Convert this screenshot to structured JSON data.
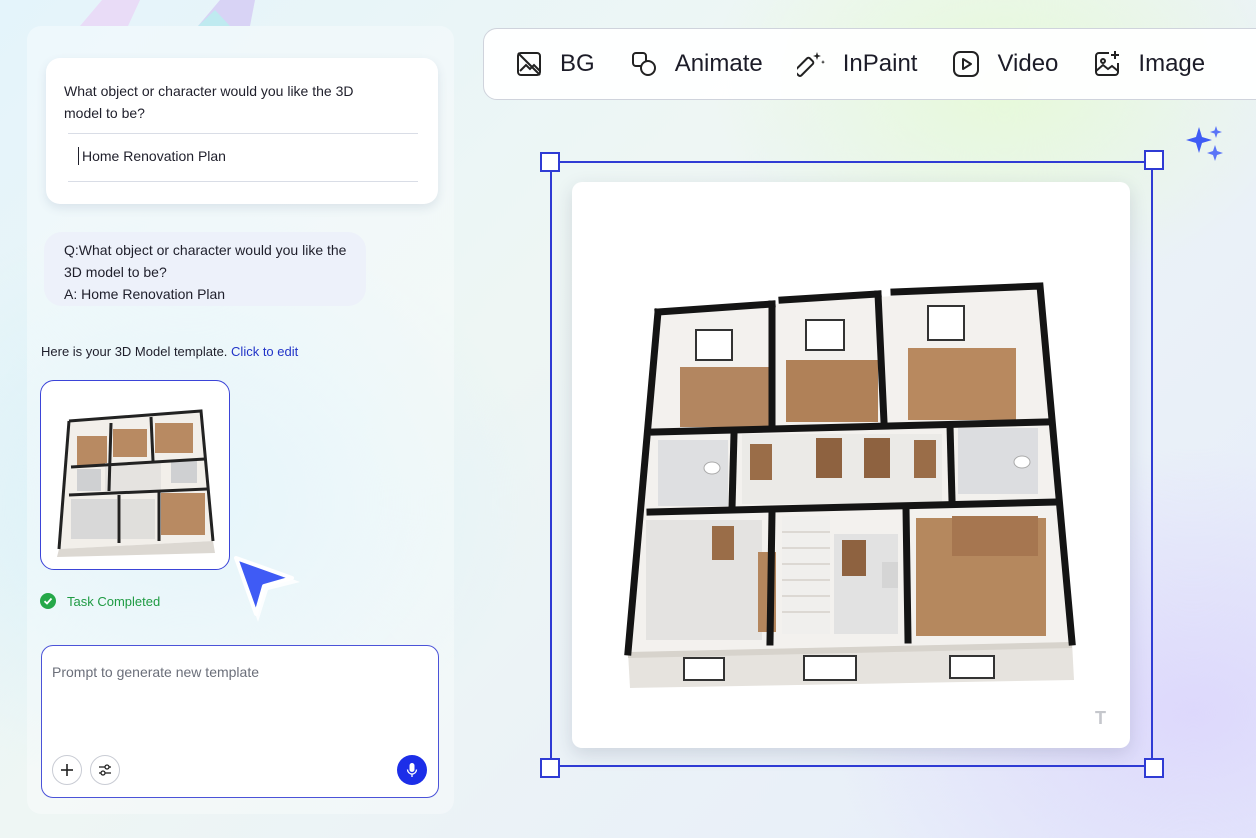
{
  "chat": {
    "question_card": {
      "question": "What object or character would you like the 3D model to be?",
      "answer_value": "Home Renovation Plan"
    },
    "summary_bubble": {
      "q_line": "Q:What object or character would you like the 3D model to be?",
      "a_line": "A: Home Renovation Plan"
    },
    "template_message": {
      "text": "Here is your 3D Model template.",
      "link": "Click to edit"
    },
    "status": {
      "text": "Task Completed",
      "color": "#1f9b43"
    },
    "prompt": {
      "placeholder": "Prompt to generate new template",
      "value": ""
    }
  },
  "toolbar": {
    "items": [
      {
        "label": "BG",
        "icon": "remove-bg-icon"
      },
      {
        "label": "Animate",
        "icon": "animate-icon"
      },
      {
        "label": "InPaint",
        "icon": "magic-wand-icon"
      },
      {
        "label": "Video",
        "icon": "play-video-icon"
      },
      {
        "label": "Image",
        "icon": "add-image-icon"
      }
    ]
  },
  "canvas": {
    "watermark": "T",
    "accent_color": "#2f3bd4"
  }
}
